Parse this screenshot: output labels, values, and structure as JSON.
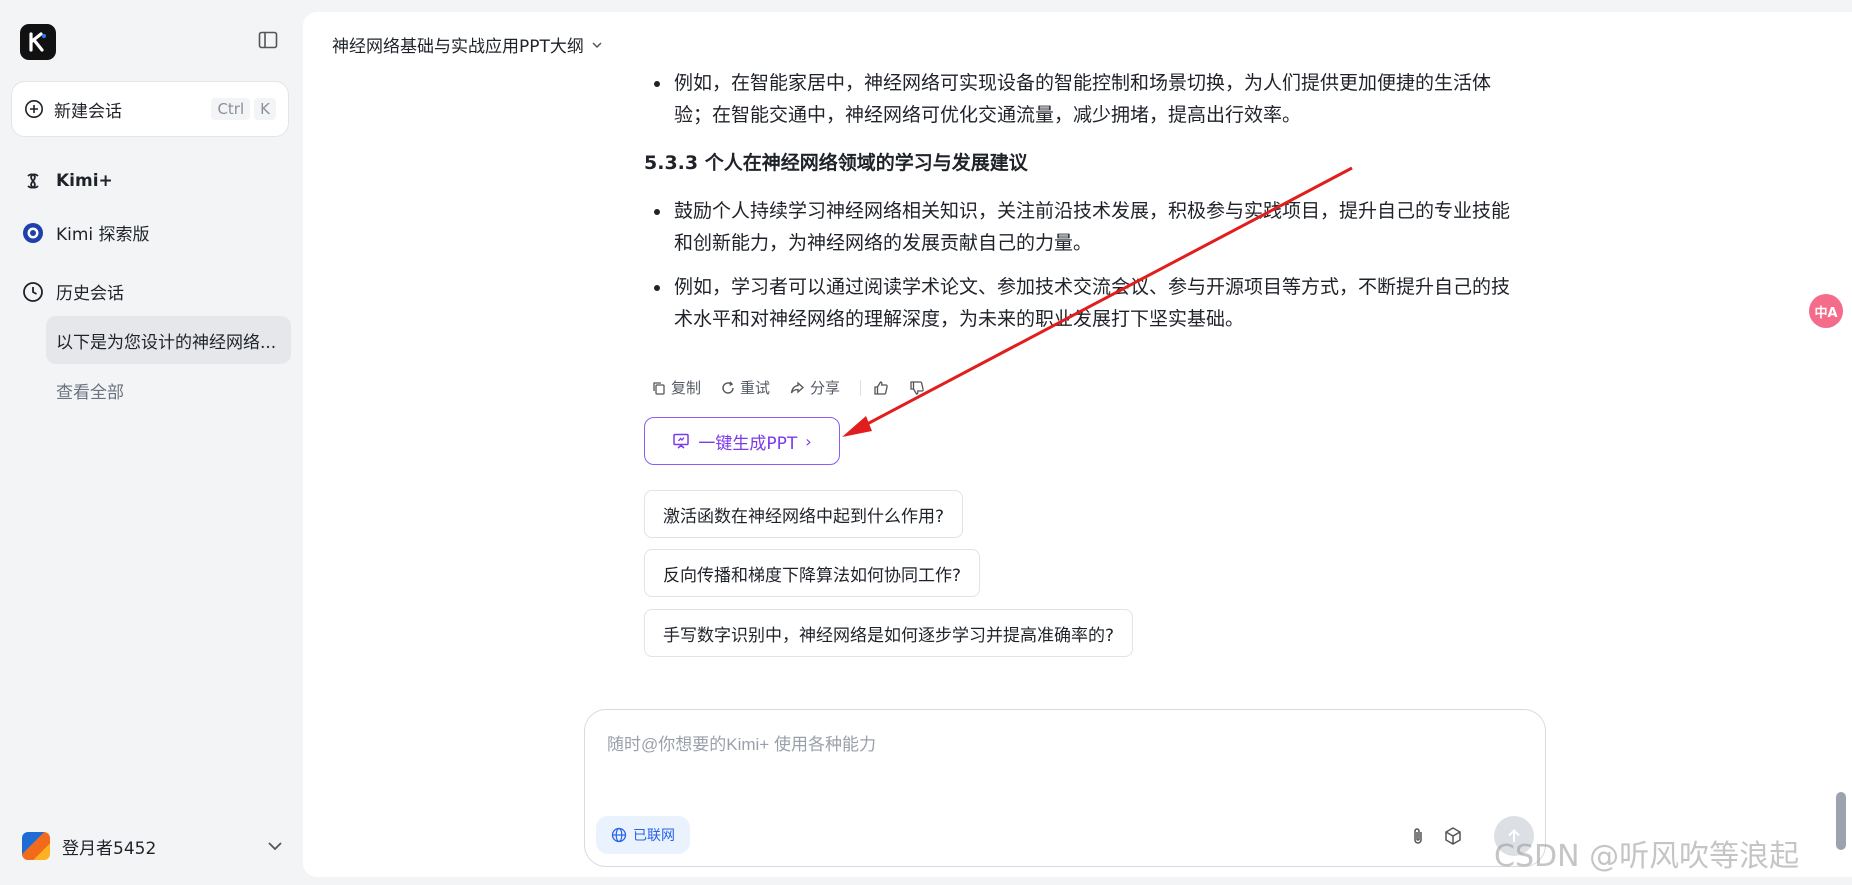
{
  "sidebar": {
    "new_chat_label": "新建会话",
    "shortcut_ctrl": "Ctrl",
    "shortcut_key": "K",
    "nav": [
      {
        "label": "Kimi+"
      },
      {
        "label": "Kimi 探索版"
      },
      {
        "label": "历史会话"
      }
    ],
    "history_item": "以下是为您设计的神经网络...",
    "view_all": "查看全部",
    "user_name": "登月者5452"
  },
  "header": {
    "chat_title": "神经网络基础与实战应用PPT大纲"
  },
  "message": {
    "bullet_1": "例如，在智能家居中，神经网络可实现设备的智能控制和场景切换，为人们提供更加便捷的生活体验；在智能交通中，神经网络可优化交通流量，减少拥堵，提高出行效率。",
    "section_heading": "5.3.3 个人在神经网络领域的学习与发展建议",
    "bullet_2": "鼓励个人持续学习神经网络相关知识，关注前沿技术发展，积极参与实践项目，提升自己的专业技能和创新能力，为神经网络的发展贡献自己的力量。",
    "bullet_3": "例如，学习者可以通过阅读学术论文、参加技术交流会议、参与开源项目等方式，不断提升自己的技术水平和对神经网络的理解深度，为未来的职业发展打下坚实基础。"
  },
  "actions": {
    "copy": "复制",
    "retry": "重试",
    "share": "分享"
  },
  "ppt_button": "一键生成PPT",
  "suggestions": [
    "激活函数在神经网络中起到什么作用?",
    "反向传播和梯度下降算法如何协同工作?",
    "手写数字识别中，神经网络是如何逐步学习并提高准确率的?"
  ],
  "input": {
    "placeholder": "随时@你想要的Kimi+ 使用各种能力",
    "network_badge": "已联网"
  },
  "watermark": "CSDN @听风吹等浪起",
  "colors": {
    "accent": "#7c3aed",
    "annotation_arrow": "#e11d1d",
    "network_blue": "#2563eb"
  }
}
